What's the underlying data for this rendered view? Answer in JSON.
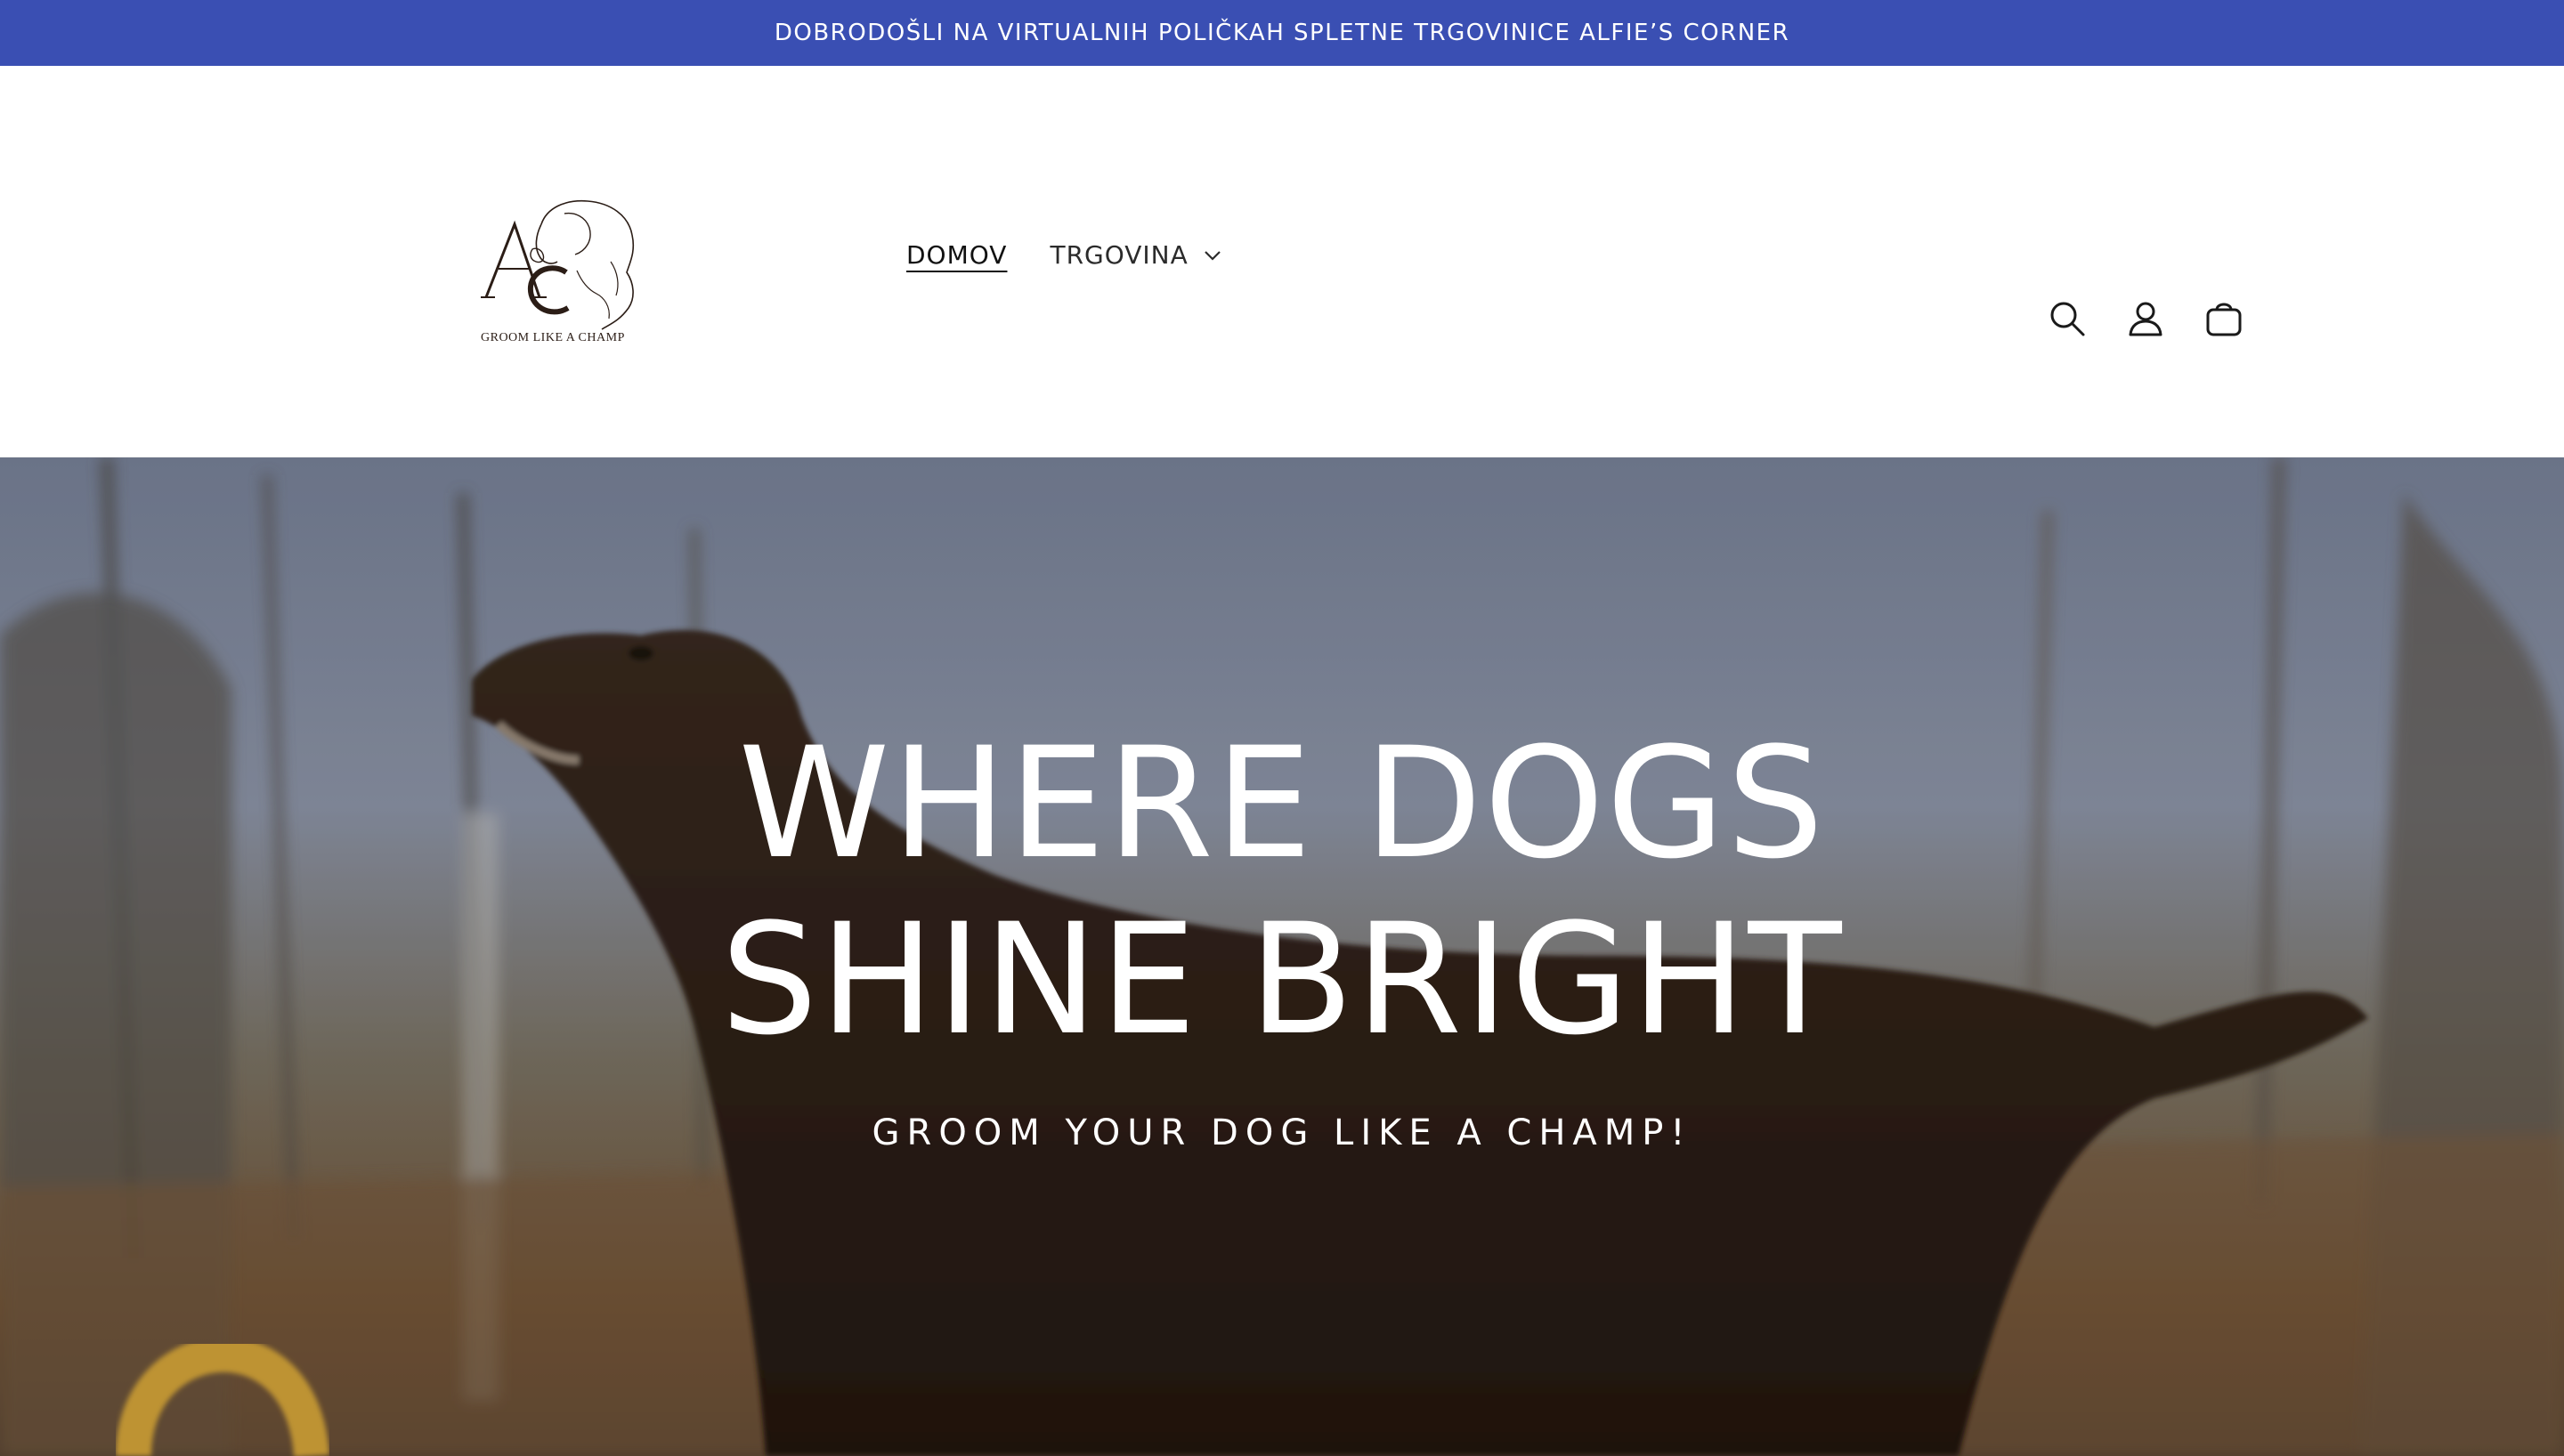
{
  "announcement": {
    "text": "DOBRODOŠLI NA VIRTUALNIH POLIČKAH SPLETNE TRGOVINICE ALFIE’S CORNER"
  },
  "header": {
    "logo": {
      "monogram": "AC",
      "tagline": "GROOM LIKE A CHAMP"
    },
    "nav": {
      "home_label": "DOMOV",
      "shop_label": "TRGOVINA"
    },
    "icons": [
      "search-icon",
      "account-icon",
      "cart-icon"
    ]
  },
  "hero": {
    "title_line1": "WHERE DOGS",
    "title_line2": "SHINE BRIGHT",
    "subtitle": "GROOM YOUR DOG LIKE A CHAMP!"
  },
  "colors": {
    "announcement_bg": "#3a4fb3",
    "text_white": "#ffffff",
    "nav_text": "#2b2b2b"
  }
}
